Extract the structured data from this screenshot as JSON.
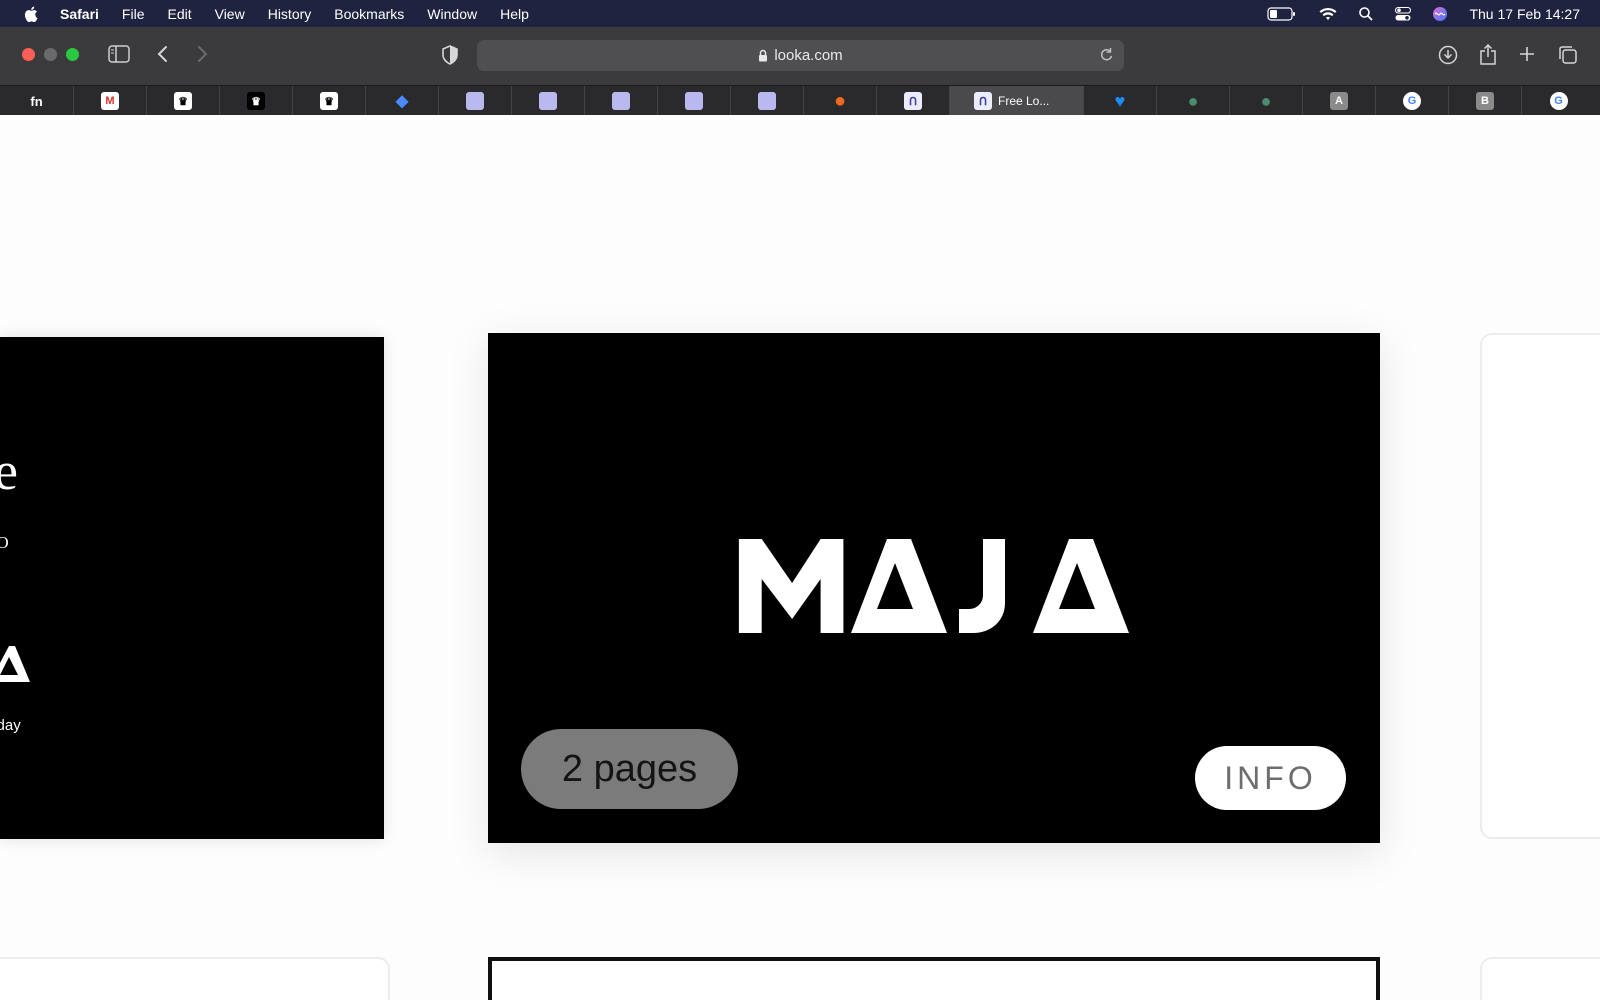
{
  "menubar": {
    "app": "Safari",
    "items": [
      "File",
      "Edit",
      "View",
      "History",
      "Bookmarks",
      "Window",
      "Help"
    ],
    "clock": "Thu 17 Feb  14:27"
  },
  "toolbar": {
    "url": "looka.com"
  },
  "tabs": [
    {
      "icon": "fn-icon",
      "glyph": "fn",
      "color": "#2a2a2c"
    },
    {
      "icon": "gmail-icon",
      "glyph": "M",
      "color": "#ffffff"
    },
    {
      "icon": "crown-icon",
      "glyph": "♛",
      "color": "#ffffff"
    },
    {
      "icon": "crown-icon",
      "glyph": "♛",
      "color": "#000000"
    },
    {
      "icon": "crown-icon",
      "glyph": "♛",
      "color": "#ffffff"
    },
    {
      "icon": "diamond-icon",
      "glyph": "◆",
      "color": "#2a2a2c"
    },
    {
      "icon": "image-icon",
      "glyph": "",
      "color": "#b9b9f0"
    },
    {
      "icon": "image-icon",
      "glyph": "",
      "color": "#b9b9f0"
    },
    {
      "icon": "image-icon",
      "glyph": "",
      "color": "#b9b9f0"
    },
    {
      "icon": "image-icon",
      "glyph": "",
      "color": "#b9b9f0"
    },
    {
      "icon": "image-icon",
      "glyph": "",
      "color": "#b9b9f0"
    },
    {
      "icon": "orange-circle-icon",
      "glyph": "●",
      "color": "#2a2a2c"
    },
    {
      "icon": "looka-icon",
      "glyph": "ᑎ",
      "color": "#ececff"
    },
    {
      "icon": "looka-icon",
      "glyph": "ᑎ",
      "color": "#ececff",
      "label": "Free Lo...",
      "active": true
    },
    {
      "icon": "heart-icon",
      "glyph": "♥",
      "color": "#2a2a2c"
    },
    {
      "icon": "globe-icon",
      "glyph": "●",
      "color": "#2a2a2c"
    },
    {
      "icon": "globe-icon",
      "glyph": "●",
      "color": "#2a2a2c"
    },
    {
      "icon": "letter-a-icon",
      "glyph": "A",
      "color": "#8a8a8a"
    },
    {
      "icon": "google-icon",
      "glyph": "G",
      "color": "#ffffff"
    },
    {
      "icon": "letter-b-icon",
      "glyph": "B",
      "color": "#8a8a8a"
    },
    {
      "icon": "google-icon",
      "glyph": "G",
      "color": "#ffffff"
    }
  ],
  "cards": {
    "left": {
      "line1": "me",
      "line2": "EO",
      "line3": "very day"
    },
    "main": {
      "logo_text": "MAJA",
      "pages_label": "2 pages",
      "info_label": "INFO"
    }
  },
  "colors": {
    "menubar_bg": "#1f2340",
    "toolbar_bg": "#3b3b3d",
    "card_bg": "#000000",
    "pill_bg": "#7b7b7b"
  }
}
